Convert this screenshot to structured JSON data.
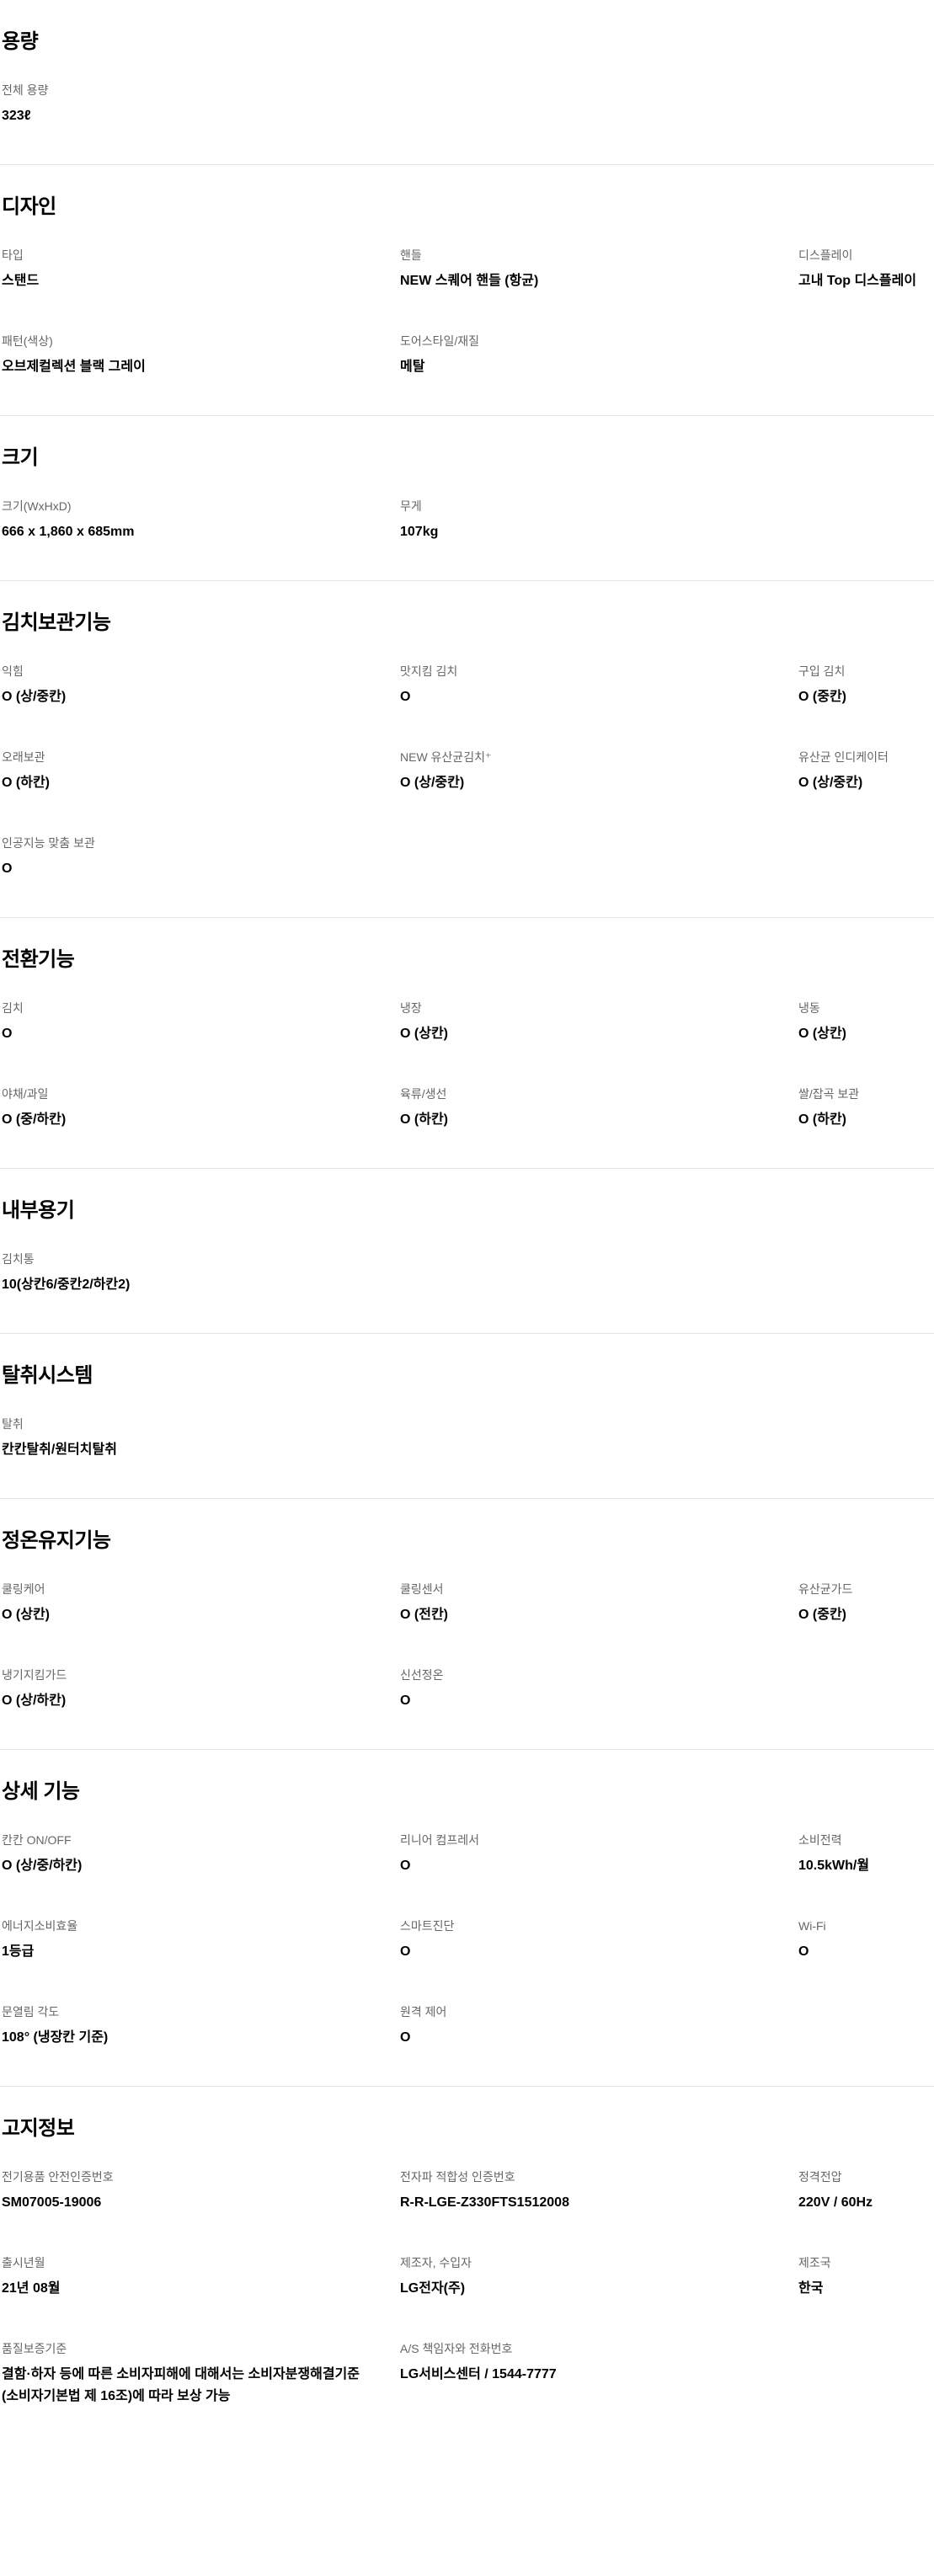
{
  "sections": [
    {
      "title": "용량",
      "items": [
        {
          "label": "전체 용량",
          "value": "323ℓ"
        }
      ]
    },
    {
      "title": "디자인",
      "items": [
        {
          "label": "타입",
          "value": "스탠드"
        },
        {
          "label": "핸들",
          "value": "NEW 스퀘어 핸들 (항균)"
        },
        {
          "label": "디스플레이",
          "value": "고내 Top 디스플레이"
        },
        {
          "label": "패턴(색상)",
          "value": "오브제컬렉션 블랙 그레이"
        },
        {
          "label": "도어스타일/재질",
          "value": "메탈"
        }
      ]
    },
    {
      "title": "크기",
      "items": [
        {
          "label": "크기(WxHxD)",
          "value": "666 x 1,860 x 685mm"
        },
        {
          "label": "무게",
          "value": "107kg"
        }
      ]
    },
    {
      "title": "김치보관기능",
      "items": [
        {
          "label": "익힘",
          "value": "O (상/중칸)"
        },
        {
          "label": "맛지킴 김치",
          "value": "O"
        },
        {
          "label": "구입 김치",
          "value": "O (중칸)"
        },
        {
          "label": "오래보관",
          "value": "O (하칸)"
        },
        {
          "label": "NEW 유산균김치⁺",
          "value": "O (상/중칸)"
        },
        {
          "label": "유산균 인디케이터",
          "value": "O (상/중칸)"
        },
        {
          "label": "인공지능 맞춤 보관",
          "value": "O"
        }
      ]
    },
    {
      "title": "전환기능",
      "items": [
        {
          "label": "김치",
          "value": "O"
        },
        {
          "label": "냉장",
          "value": "O (상칸)"
        },
        {
          "label": "냉동",
          "value": "O (상칸)"
        },
        {
          "label": "야채/과일",
          "value": "O (중/하칸)"
        },
        {
          "label": "육류/생선",
          "value": "O (하칸)"
        },
        {
          "label": "쌀/잡곡 보관",
          "value": "O (하칸)"
        }
      ]
    },
    {
      "title": "내부용기",
      "items": [
        {
          "label": "김치통",
          "value": "10(상칸6/중칸2/하칸2)"
        }
      ]
    },
    {
      "title": "탈취시스템",
      "items": [
        {
          "label": "탈취",
          "value": "칸칸탈취/원터치탈취"
        }
      ]
    },
    {
      "title": "정온유지기능",
      "items": [
        {
          "label": "쿨링케어",
          "value": "O (상칸)"
        },
        {
          "label": "쿨링센서",
          "value": "O (전칸)"
        },
        {
          "label": "유산균가드",
          "value": "O (중칸)"
        },
        {
          "label": "냉기지킴가드",
          "value": "O (상/하칸)"
        },
        {
          "label": "신선정온",
          "value": "O"
        }
      ]
    },
    {
      "title": "상세 기능",
      "items": [
        {
          "label": "칸칸 ON/OFF",
          "value": "O (상/중/하칸)"
        },
        {
          "label": "리니어 컴프레서",
          "value": "O"
        },
        {
          "label": "소비전력",
          "value": "10.5kWh/월"
        },
        {
          "label": "에너지소비효율",
          "value": "1등급"
        },
        {
          "label": "스마트진단",
          "value": "O"
        },
        {
          "label": "Wi-Fi",
          "value": "O"
        },
        {
          "label": "문열림 각도",
          "value": "108° (냉장칸 기준)"
        },
        {
          "label": "원격 제어",
          "value": "O"
        }
      ]
    },
    {
      "title": "고지정보",
      "items": [
        {
          "label": "전기용품 안전인증번호",
          "value": "SM07005-19006"
        },
        {
          "label": "전자파 적합성 인증번호",
          "value": "R-R-LGE-Z330FTS1512008"
        },
        {
          "label": "정격전압",
          "value": "220V / 60Hz"
        },
        {
          "label": "출시년월",
          "value": "21년 08월"
        },
        {
          "label": "제조자, 수입자",
          "value": "LG전자(주)"
        },
        {
          "label": "제조국",
          "value": "한국"
        },
        {
          "label": "품질보증기준",
          "value": "결함·하자 등에 따른 소비자피해에 대해서는 소비자분쟁해결기준\n(소비자기본법 제 16조)에 따라 보상 가능"
        },
        {
          "label": "A/S 책임자와 전화번호",
          "value": "LG서비스센터 / 1544-7777"
        }
      ]
    }
  ]
}
